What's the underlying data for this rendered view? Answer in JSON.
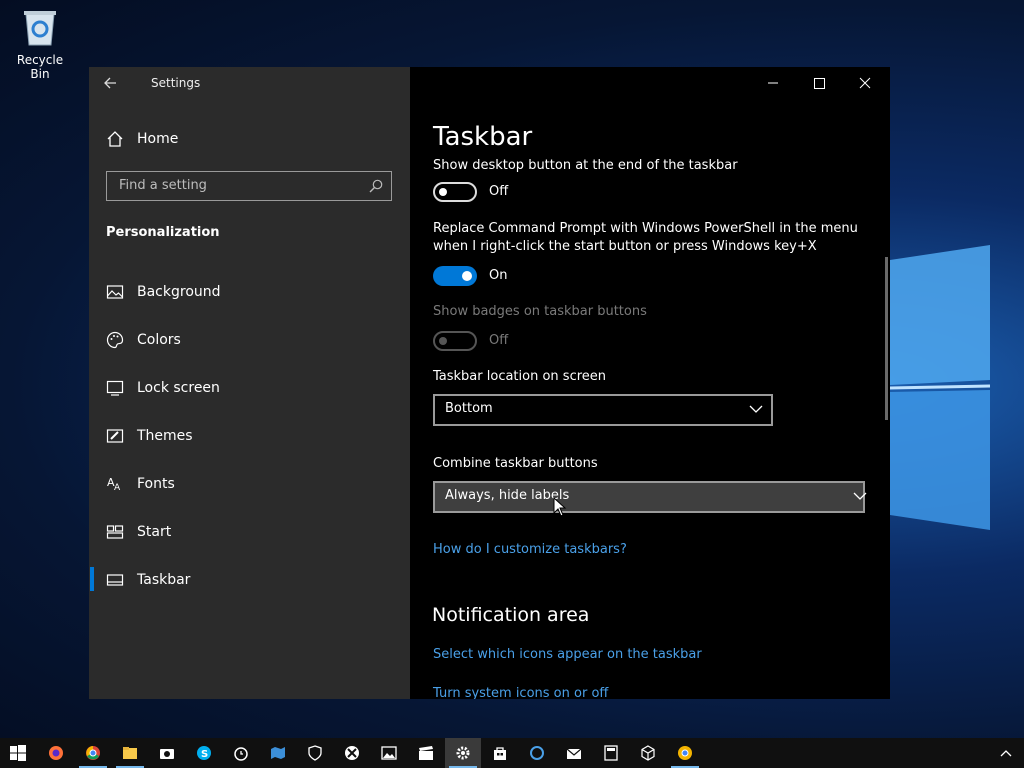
{
  "desktop": {
    "recycle_bin_label": "Recycle Bin"
  },
  "window": {
    "title": "Settings",
    "sidebar": {
      "home_label": "Home",
      "search_placeholder": "Find a setting",
      "section_title": "Personalization",
      "items": [
        {
          "label": "Background",
          "icon": "picture-icon"
        },
        {
          "label": "Colors",
          "icon": "palette-icon"
        },
        {
          "label": "Lock screen",
          "icon": "monitor-lock-icon"
        },
        {
          "label": "Themes",
          "icon": "brush-icon"
        },
        {
          "label": "Fonts",
          "icon": "font-icon"
        },
        {
          "label": "Start",
          "icon": "start-grid-icon"
        },
        {
          "label": "Taskbar",
          "icon": "taskbar-icon",
          "selected": true
        }
      ]
    },
    "main": {
      "page_title": "Taskbar",
      "partial_setting_label": "Show desktop button at the end of the taskbar",
      "partial_setting_state": "Off",
      "powershell_label_line1": "Replace Command Prompt with Windows PowerShell in the menu",
      "powershell_label_line2": "when I right-click the start button or press Windows key+X",
      "powershell_state": "On",
      "badges_label": "Show badges on taskbar buttons",
      "badges_state": "Off",
      "location_label": "Taskbar location on screen",
      "location_value": "Bottom",
      "combine_label": "Combine taskbar buttons",
      "combine_value": "Always, hide labels",
      "customize_link": "How do I customize taskbars?",
      "notification_heading": "Notification area",
      "select_icons_link": "Select which icons appear on the taskbar",
      "system_icons_link": "Turn system icons on or off"
    }
  },
  "colors": {
    "accent": "#0078d7",
    "link": "#4aa0e8",
    "sidebar_bg": "#2b2b2b"
  },
  "taskbar": {
    "icons": [
      "start-icon",
      "firefox-icon",
      "chrome-icon",
      "file-explorer-icon",
      "camera-icon",
      "skype-icon",
      "alarms-icon",
      "maps-icon",
      "defender-icon",
      "xbox-icon",
      "photos-icon",
      "movies-icon",
      "settings-icon",
      "store-icon",
      "cortana-icon",
      "mail-icon",
      "calculator-icon",
      "3d-viewer-icon",
      "chrome-canary-icon"
    ]
  }
}
